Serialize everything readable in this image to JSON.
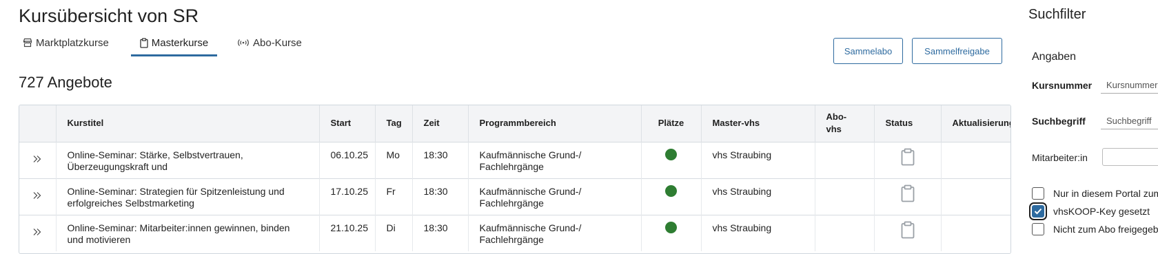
{
  "page": {
    "title": "Kursübersicht von SR"
  },
  "tabs": [
    {
      "label": "Marktplatzkurse",
      "icon": "storefront-icon"
    },
    {
      "label": "Masterkurse",
      "icon": "clipboard-icon",
      "active": true
    },
    {
      "label": "Abo-Kurse",
      "icon": "broadcast-icon"
    }
  ],
  "actions": {
    "sammelabo": "Sammelabo",
    "sammelfreigabe": "Sammelfreigabe"
  },
  "results": {
    "count_label": "727 Angebote"
  },
  "table": {
    "columns": [
      "",
      "Kurstitel",
      "Start",
      "Tag",
      "Zeit",
      "Programmbereich",
      "Plätze",
      "Master-vhs",
      "Abo-vhs",
      "Status",
      "Aktualisierung"
    ],
    "rows": [
      {
        "title": "Online-Seminar: Stärke, Selbstvertrauen, Überzeugungskraft und",
        "start": "06.10.25",
        "tag": "Mo",
        "zeit": "18:30",
        "bereich": "Kaufmännische Grund-/ Fachlehrgänge",
        "plaetze_status": "available",
        "master_vhs": "vhs Straubing",
        "abo_vhs": "",
        "status_icon": "clipboard-icon"
      },
      {
        "title": "Online-Seminar: Strategien für Spitzenleistung und erfolgreiches Selbstmarketing",
        "start": "17.10.25",
        "tag": "Fr",
        "zeit": "18:30",
        "bereich": "Kaufmännische Grund-/ Fachlehrgänge",
        "plaetze_status": "available",
        "master_vhs": "vhs Straubing",
        "abo_vhs": "",
        "status_icon": "clipboard-icon"
      },
      {
        "title": "Online-Seminar: Mitarbeiter:innen gewinnen, binden und motivieren",
        "start": "21.10.25",
        "tag": "Di",
        "zeit": "18:30",
        "bereich": "Kaufmännische Grund-/ Fachlehrgänge",
        "plaetze_status": "available",
        "master_vhs": "vhs Straubing",
        "abo_vhs": "",
        "status_icon": "clipboard-icon"
      }
    ]
  },
  "filter": {
    "title": "Suchfilter",
    "section": "Angaben",
    "kursnummer": {
      "label": "Kursnummer",
      "placeholder": "Kursnummer"
    },
    "suchbegriff": {
      "label": "Suchbegriff",
      "placeholder": "Suchbegriff"
    },
    "mitarbeiter": {
      "label": "Mitarbeiter:in",
      "value": ""
    },
    "checkboxes": [
      {
        "label": "Nur in diesem Portal zum Abo",
        "checked": false
      },
      {
        "label": "vhsKOOP-Key gesetzt",
        "checked": true
      },
      {
        "label": "Nicht zum Abo freigegeben",
        "checked": false
      }
    ]
  },
  "colors": {
    "accent": "#2d6a9f",
    "available": "#2e7d32",
    "header_bg": "#f3f4f6"
  }
}
